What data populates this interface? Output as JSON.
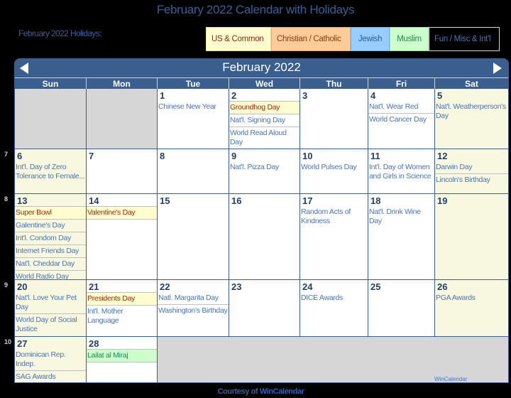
{
  "page_title": "February 2022 Calendar with Holidays",
  "holidays_label": "February 2022 Holidays:",
  "legend": [
    {
      "label": "US & Common",
      "color": "#fffdd0"
    },
    {
      "label": "Christian / Catholic",
      "color": "#ffcc99"
    },
    {
      "label": "Jewish",
      "color": "#99ccff"
    },
    {
      "label": "Muslim",
      "color": "#ccffcc"
    },
    {
      "label": "Fun / Misc & Int'l",
      "color": "#000000"
    }
  ],
  "calendar": {
    "month_title": "February 2022",
    "prev_icon": "triangle-left-icon",
    "next_icon": "triangle-right-icon",
    "weekdays": [
      "Sun",
      "Mon",
      "Tue",
      "Wed",
      "Thu",
      "Fri",
      "Sat"
    ],
    "week_numbers": [
      "7",
      "8",
      "9",
      "10"
    ],
    "weeks": [
      [
        {
          "day": "",
          "events": []
        },
        {
          "day": "",
          "events": []
        },
        {
          "day": "1",
          "events": [
            {
              "name": "Chinese New Year",
              "type": "fun"
            }
          ]
        },
        {
          "day": "2",
          "events": [
            {
              "name": "Groundhog Day",
              "type": "us"
            },
            {
              "name": "Nat'l. Signing Day",
              "type": "fun"
            },
            {
              "name": "World Read Aloud Day",
              "type": "fun"
            }
          ]
        },
        {
          "day": "3",
          "events": []
        },
        {
          "day": "4",
          "events": [
            {
              "name": "Nat'l. Wear Red",
              "type": "fun"
            },
            {
              "name": "World Cancer Day",
              "type": "fun"
            }
          ]
        },
        {
          "day": "5",
          "events": [
            {
              "name": "Nat'l. Weatherperson's Day",
              "type": "fun"
            }
          ]
        }
      ],
      [
        {
          "day": "6",
          "events": [
            {
              "name": "Int'l. Day of Zero Tolerance to Female...",
              "type": "fun"
            }
          ]
        },
        {
          "day": "7",
          "events": []
        },
        {
          "day": "8",
          "events": []
        },
        {
          "day": "9",
          "events": [
            {
              "name": "Nat'l. Pizza Day",
              "type": "fun"
            }
          ]
        },
        {
          "day": "10",
          "events": [
            {
              "name": "World Pulses Day",
              "type": "fun"
            }
          ]
        },
        {
          "day": "11",
          "events": [
            {
              "name": "Int'l. Day of Women and Girls in Science",
              "type": "fun"
            }
          ]
        },
        {
          "day": "12",
          "events": [
            {
              "name": "Darwin Day",
              "type": "fun"
            },
            {
              "name": "Lincoln's Birthday",
              "type": "fun"
            }
          ]
        }
      ],
      [
        {
          "day": "13",
          "events": [
            {
              "name": "Super Bowl",
              "type": "us"
            },
            {
              "name": "Galentine's Day",
              "type": "fun"
            },
            {
              "name": "Int'l. Condom Day",
              "type": "fun"
            },
            {
              "name": "Internet Friends Day",
              "type": "fun"
            },
            {
              "name": "Nat'l. Cheddar Day",
              "type": "fun"
            },
            {
              "name": "World Radio Day",
              "type": "fun"
            }
          ]
        },
        {
          "day": "14",
          "events": [
            {
              "name": "Valentine's Day",
              "type": "us"
            }
          ]
        },
        {
          "day": "15",
          "events": []
        },
        {
          "day": "16",
          "events": []
        },
        {
          "day": "17",
          "events": [
            {
              "name": "Random Acts of Kindness",
              "type": "fun"
            }
          ]
        },
        {
          "day": "18",
          "events": [
            {
              "name": "Nat'l. Drink Wine Day",
              "type": "fun"
            }
          ]
        },
        {
          "day": "19",
          "events": []
        }
      ],
      [
        {
          "day": "20",
          "events": [
            {
              "name": "Nat'l. Love Your Pet Day",
              "type": "fun"
            },
            {
              "name": "World Day of Social Justice",
              "type": "fun"
            }
          ]
        },
        {
          "day": "21",
          "events": [
            {
              "name": "Presidents Day",
              "type": "us"
            },
            {
              "name": "Int'l. Mother Language",
              "type": "fun"
            }
          ]
        },
        {
          "day": "22",
          "events": [
            {
              "name": "Natl. Margarita Day",
              "type": "fun"
            },
            {
              "name": "Washington's Birthday",
              "type": "fun"
            }
          ]
        },
        {
          "day": "23",
          "events": []
        },
        {
          "day": "24",
          "events": [
            {
              "name": "DICE Awards",
              "type": "fun"
            }
          ]
        },
        {
          "day": "25",
          "events": []
        },
        {
          "day": "26",
          "events": [
            {
              "name": "PGA Awards",
              "type": "fun"
            }
          ]
        }
      ],
      [
        {
          "day": "27",
          "events": [
            {
              "name": "Dominican Rep. Indep.",
              "type": "fun"
            },
            {
              "name": "SAG Awards",
              "type": "fun"
            }
          ]
        },
        {
          "day": "28",
          "events": [
            {
              "name": "Lailat al Miraj",
              "type": "muslim"
            }
          ]
        }
      ]
    ],
    "watermark": "WinCalendar"
  },
  "footer": {
    "courtesy_prefix": "Courtesy of",
    "courtesy_link": "WinCalendar"
  }
}
